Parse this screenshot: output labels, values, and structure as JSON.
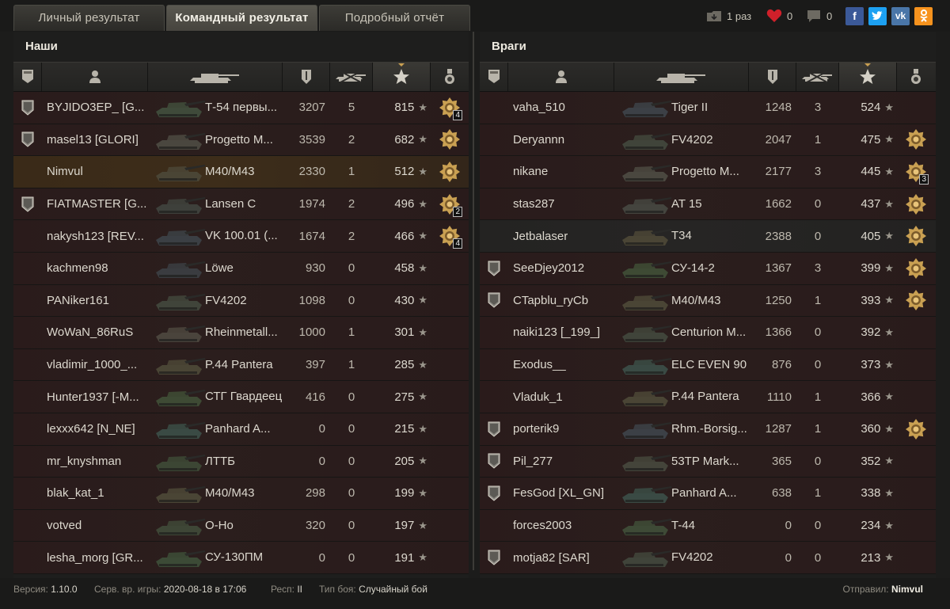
{
  "tabs": [
    {
      "label": "Личный результат",
      "active": false
    },
    {
      "label": "Командный результат",
      "active": true
    },
    {
      "label": "Подробный отчёт",
      "active": false
    }
  ],
  "social": {
    "screenshot_count": "1 раз",
    "likes": "0",
    "comments": "0",
    "icons": [
      "facebook-icon",
      "twitter-icon",
      "vk-icon",
      "odnoklassniki-icon"
    ]
  },
  "teams": {
    "ours": {
      "title": "Наши",
      "players": [
        {
          "rank": "1",
          "name": "BYJIDO3EP_ [G...",
          "tank": "Т-54 первы...",
          "damage": "3207",
          "kills": "5",
          "xp": "815",
          "medal": "4",
          "tank_color": "#3f4a3a"
        },
        {
          "rank": "1",
          "name": "masel13 [GLORI]",
          "tank": "Progetto M...",
          "damage": "3539",
          "kills": "2",
          "xp": "682",
          "medal": "1",
          "tank_color": "#4a473f"
        },
        {
          "rank": "",
          "name": "Nimvul",
          "tank": "M40/M43",
          "damage": "2330",
          "kills": "1",
          "xp": "512",
          "medal": "1",
          "self": true,
          "tank_color": "#4a4535"
        },
        {
          "rank": "1",
          "name": "FIATMASTER [G...",
          "tank": "Lansen C",
          "damage": "1974",
          "kills": "2",
          "xp": "496",
          "medal": "2",
          "tank_color": "#3e403b"
        },
        {
          "rank": "",
          "name": "nakysh123 [REV...",
          "tank": "VK 100.01 (...",
          "damage": "1674",
          "kills": "2",
          "xp": "466",
          "medal": "4",
          "tank_color": "#3b3f44"
        },
        {
          "rank": "",
          "name": "kachmen98",
          "tank": "Löwe",
          "damage": "930",
          "kills": "0",
          "xp": "458",
          "medal": "",
          "tank_color": "#3a3c40"
        },
        {
          "rank": "",
          "name": "PANiker161",
          "tank": "FV4202",
          "damage": "1098",
          "kills": "0",
          "xp": "430",
          "medal": "",
          "tank_color": "#40443a"
        },
        {
          "rank": "",
          "name": "WoWaN_86RuS",
          "tank": "Rheinmetall...",
          "damage": "1000",
          "kills": "1",
          "xp": "301",
          "medal": "",
          "tank_color": "#4a443c"
        },
        {
          "rank": "",
          "name": "vladimir_1000_...",
          "tank": "P.44 Pantera",
          "damage": "397",
          "kills": "1",
          "xp": "285",
          "medal": "",
          "tank_color": "#4a4535"
        },
        {
          "rank": "",
          "name": "Hunter1937 [-M...",
          "tank": "СТГ Гвардеец",
          "damage": "416",
          "kills": "0",
          "xp": "275",
          "medal": "",
          "tank_color": "#3e4a34"
        },
        {
          "rank": "",
          "name": "lexxx642 [N_NE]",
          "tank": "Panhard A...",
          "damage": "0",
          "kills": "0",
          "xp": "215",
          "medal": "",
          "tank_color": "#3a4a44"
        },
        {
          "rank": "",
          "name": "mr_knyshman",
          "tank": "ЛТТБ",
          "damage": "0",
          "kills": "0",
          "xp": "205",
          "medal": "",
          "tank_color": "#3c4634"
        },
        {
          "rank": "",
          "name": "blak_kat_1",
          "tank": "M40/M43",
          "damage": "298",
          "kills": "0",
          "xp": "199",
          "medal": "",
          "tank_color": "#4a4535"
        },
        {
          "rank": "",
          "name": "votved",
          "tank": "O-Ho",
          "damage": "320",
          "kills": "0",
          "xp": "197",
          "medal": "",
          "tank_color": "#3e4636"
        },
        {
          "rank": "",
          "name": "lesha_morg [GR...",
          "tank": "СУ-130ПМ",
          "damage": "0",
          "kills": "0",
          "xp": "191",
          "medal": "",
          "tank_color": "#3c4a36"
        }
      ]
    },
    "enemies": {
      "title": "Враги",
      "players": [
        {
          "rank": "",
          "name": "vaha_510",
          "tank": "Tiger II",
          "damage": "1248",
          "kills": "3",
          "xp": "524",
          "medal": "",
          "tank_color": "#3c4046"
        },
        {
          "rank": "",
          "name": "Deryannn",
          "tank": "FV4202",
          "damage": "2047",
          "kills": "1",
          "xp": "475",
          "medal": "1",
          "tank_color": "#40443a"
        },
        {
          "rank": "",
          "name": "nikane",
          "tank": "Progetto M...",
          "damage": "2177",
          "kills": "3",
          "xp": "445",
          "medal": "3",
          "tank_color": "#4a473f"
        },
        {
          "rank": "",
          "name": "stas287",
          "tank": "AT 15",
          "damage": "1662",
          "kills": "0",
          "xp": "437",
          "medal": "1",
          "tank_color": "#44443e"
        },
        {
          "rank": "",
          "name": "Jetbalaser",
          "tank": "T34",
          "damage": "2388",
          "kills": "0",
          "xp": "405",
          "medal": "1",
          "plain": true,
          "tank_color": "#4a4535"
        },
        {
          "rank": "1",
          "name": "SeeDjey2012",
          "tank": "СУ-14-2",
          "damage": "1367",
          "kills": "3",
          "xp": "399",
          "medal": "1",
          "tank_color": "#3e4a34"
        },
        {
          "rank": "2",
          "name": "CTapblu_ryCb",
          "tank": "M40/M43",
          "damage": "1250",
          "kills": "1",
          "xp": "393",
          "medal": "1",
          "tank_color": "#4a4535"
        },
        {
          "rank": "",
          "name": "naiki123 [_199_]",
          "tank": "Centurion M...",
          "damage": "1366",
          "kills": "0",
          "xp": "392",
          "medal": "",
          "tank_color": "#40443a"
        },
        {
          "rank": "",
          "name": "Exodus__",
          "tank": "ELC EVEN 90",
          "damage": "876",
          "kills": "0",
          "xp": "373",
          "medal": "",
          "tank_color": "#3a4a44"
        },
        {
          "rank": "",
          "name": "Vladuk_1",
          "tank": "P.44 Pantera",
          "damage": "1110",
          "kills": "1",
          "xp": "366",
          "medal": "",
          "tank_color": "#4a4535"
        },
        {
          "rank": "3",
          "name": "porterik9",
          "tank": "Rhm.-Borsig...",
          "damage": "1287",
          "kills": "1",
          "xp": "360",
          "medal": "1",
          "tank_color": "#3c4046"
        },
        {
          "rank": "2",
          "name": "Pil_277",
          "tank": "53TP Mark...",
          "damage": "365",
          "kills": "0",
          "xp": "352",
          "medal": "",
          "tank_color": "#44443a"
        },
        {
          "rank": "1",
          "name": "FesGod [XL_GN]",
          "tank": "Panhard A...",
          "damage": "638",
          "kills": "1",
          "xp": "338",
          "medal": "",
          "tank_color": "#3a4a44"
        },
        {
          "rank": "",
          "name": "forces2003",
          "tank": "T-44",
          "damage": "0",
          "kills": "0",
          "xp": "234",
          "medal": "",
          "tank_color": "#3e4a36"
        },
        {
          "rank": "3",
          "name": "motja82 [SAR]",
          "tank": "FV4202",
          "damage": "0",
          "kills": "0",
          "xp": "213",
          "medal": "",
          "tank_color": "#40443a"
        }
      ]
    }
  },
  "footer": {
    "version_label": "Версия:",
    "version": "1.10.0",
    "server_time_label": "Серв. вр. игры:",
    "server_time": "2020-08-18 в 17:06",
    "resp_label": "Респ:",
    "resp": "II",
    "battle_type_label": "Тип боя:",
    "battle_type": "Случайный бой",
    "sender_label": "Отправил:",
    "sender": "Nimvul"
  },
  "colors": {
    "background": "#1c1c1b",
    "row_enemy_red": "#2b1e1d",
    "self_row": "#3d2d1a",
    "medal_gold": "#c9a052",
    "facebook": "#3b5998",
    "twitter": "#1da1f2",
    "vk": "#4a76a8",
    "ok": "#f7931e",
    "heart": "#d0202a"
  }
}
